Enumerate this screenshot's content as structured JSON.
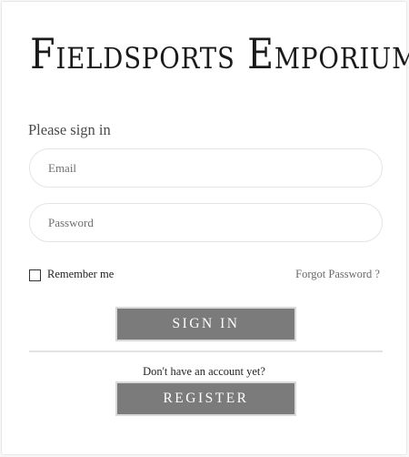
{
  "brand": {
    "logo_text": "Fieldsports Emporium"
  },
  "form": {
    "heading": "Please sign in",
    "email": {
      "placeholder": "Email",
      "value": ""
    },
    "password": {
      "placeholder": "Password",
      "value": ""
    },
    "remember_label": "Remember me",
    "remember_checked": false,
    "forgot_label": "Forgot Password ?",
    "signin_label": "SIGN IN",
    "no_account_text": "Don't have an account yet?",
    "register_label": "REGISTER"
  },
  "icons": {
    "remember_checkbox": "checkbox-unchecked"
  },
  "colors": {
    "button_bg": "#7b7b7b",
    "button_border": "#d9d9d9",
    "button_text": "#ffffff",
    "field_border": "#e4e4e4"
  }
}
